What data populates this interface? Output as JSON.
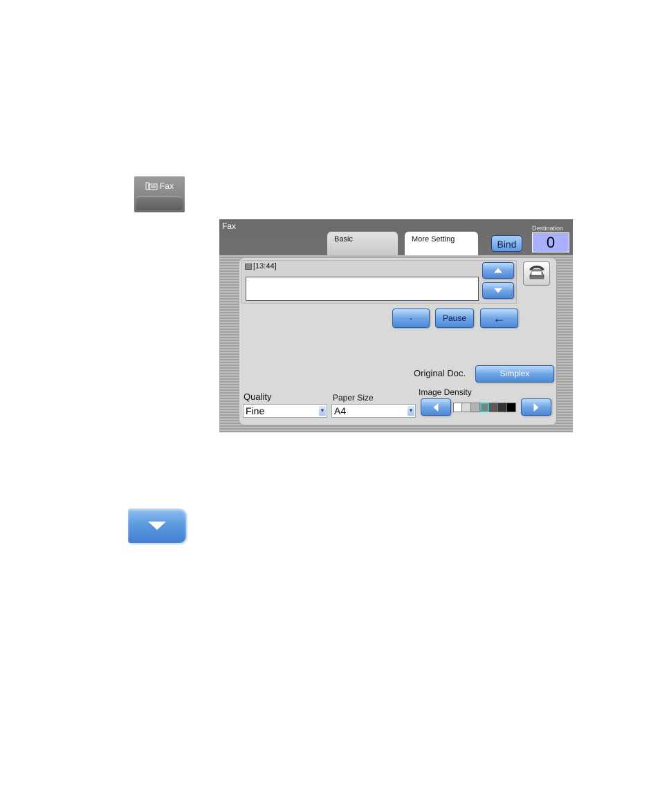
{
  "fax_key": {
    "label": "Fax",
    "icon": "fax-icon"
  },
  "scroll_down_key": {
    "icon": "triangle-down-icon"
  },
  "panel": {
    "title": "Fax",
    "tabs": [
      {
        "label": "Basic"
      },
      {
        "label": "More Setting",
        "active": true
      }
    ],
    "bind_label": "Bind",
    "destination": {
      "label": "Destination",
      "count": "0"
    },
    "entry": {
      "timestamp": "[13:44]",
      "value": ""
    },
    "function_buttons": {
      "hyphen": "-",
      "pause": "Pause",
      "backspace": "←"
    },
    "original_doc": {
      "label": "Original Doc.",
      "value": "Simplex"
    },
    "quality": {
      "label": "Quality",
      "value": "Fine"
    },
    "paper_size": {
      "label": "Paper Size",
      "value": "A4"
    },
    "image_density": {
      "label": "Image Density",
      "levels": 7,
      "selected_level": 4,
      "colors": [
        "#ffffff",
        "#d9d9d9",
        "#b3b3b3",
        "#808080",
        "#595959",
        "#333333",
        "#000000"
      ],
      "selected_color": "#38c8c8"
    }
  },
  "colors": {
    "button_blue": "#5f9ae2",
    "destination_bg": "#a9b0ff",
    "panel_gray": "#808080"
  }
}
